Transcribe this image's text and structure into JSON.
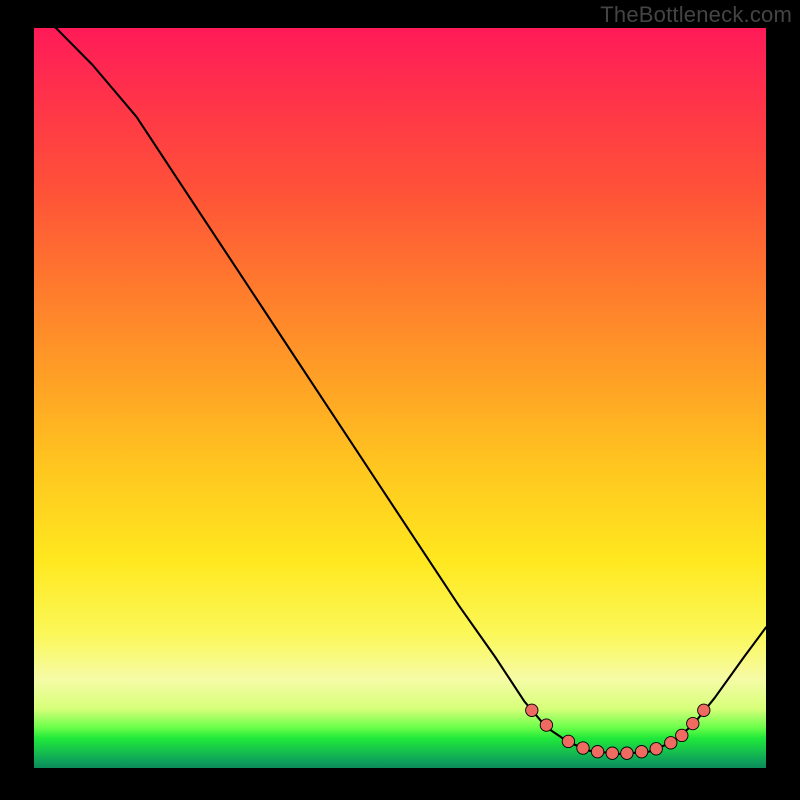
{
  "watermark": "TheBottleneck.com",
  "chart_data": {
    "type": "line",
    "title": "",
    "xlabel": "",
    "ylabel": "",
    "xlim": [
      0,
      100
    ],
    "ylim": [
      0,
      100
    ],
    "curve": [
      {
        "x": 0,
        "y": 102
      },
      {
        "x": 3,
        "y": 100
      },
      {
        "x": 8,
        "y": 95
      },
      {
        "x": 14,
        "y": 88
      },
      {
        "x": 20,
        "y": 79
      },
      {
        "x": 28,
        "y": 67
      },
      {
        "x": 36,
        "y": 55
      },
      {
        "x": 44,
        "y": 43
      },
      {
        "x": 52,
        "y": 31
      },
      {
        "x": 58,
        "y": 22
      },
      {
        "x": 63,
        "y": 15
      },
      {
        "x": 67,
        "y": 9
      },
      {
        "x": 70,
        "y": 5.5
      },
      {
        "x": 73,
        "y": 3.5
      },
      {
        "x": 76,
        "y": 2.3
      },
      {
        "x": 80,
        "y": 1.9
      },
      {
        "x": 84,
        "y": 2.2
      },
      {
        "x": 87,
        "y": 3.4
      },
      {
        "x": 90,
        "y": 5.8
      },
      {
        "x": 93,
        "y": 9.5
      },
      {
        "x": 97,
        "y": 15
      },
      {
        "x": 100,
        "y": 19
      }
    ],
    "markers": [
      {
        "x": 68,
        "y": 7.8
      },
      {
        "x": 70,
        "y": 5.8
      },
      {
        "x": 73,
        "y": 3.6
      },
      {
        "x": 75,
        "y": 2.7
      },
      {
        "x": 77,
        "y": 2.2
      },
      {
        "x": 79,
        "y": 2.0
      },
      {
        "x": 81,
        "y": 2.0
      },
      {
        "x": 83,
        "y": 2.2
      },
      {
        "x": 85,
        "y": 2.6
      },
      {
        "x": 87,
        "y": 3.4
      },
      {
        "x": 88.5,
        "y": 4.4
      },
      {
        "x": 90,
        "y": 6.0
      },
      {
        "x": 91.5,
        "y": 7.8
      }
    ],
    "marker_radius": 6.2
  }
}
